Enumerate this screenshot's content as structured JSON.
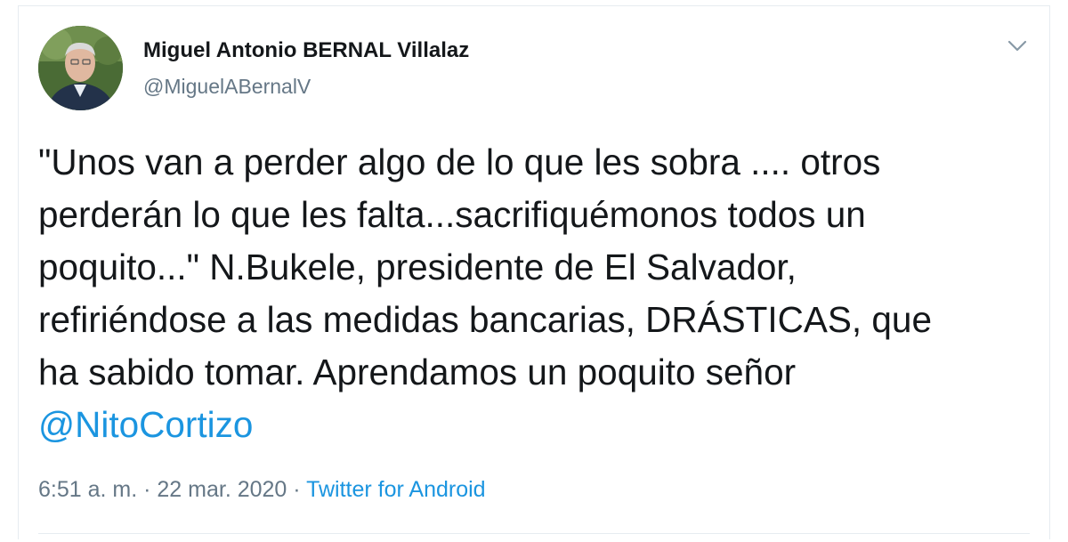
{
  "author": {
    "name": "Miguel Antonio BERNAL Villalaz",
    "handle": "@MiguelABernalV"
  },
  "tweet": {
    "lines": [
      "\"Unos van a perder algo de lo que les sobra .... otros",
      "perderán lo que les falta...sacrifiquémonos  todos un",
      "poquito...\" N.Bukele, presidente de El Salvador,",
      "refiriéndose a las medidas bancarias, DRÁSTICAS, que",
      "ha sabido tomar. Aprendamos un poquito señor"
    ],
    "mention": "@NitoCortizo"
  },
  "meta": {
    "time": "6:51 a. m.",
    "separator1": " · ",
    "date": "22 mar. 2020",
    "separator2": " · ",
    "source": "Twitter for Android"
  },
  "colors": {
    "link": "#1b95e0",
    "secondary_text": "#657786",
    "primary_text": "#14171a",
    "border": "#e6ecf0"
  },
  "icons": {
    "caret": "chevron-down-icon",
    "avatar": "user-avatar"
  }
}
